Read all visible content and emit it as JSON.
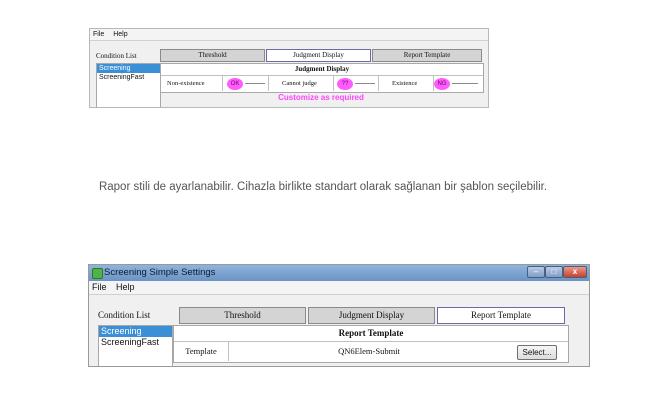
{
  "shot1": {
    "menu": [
      "File",
      "Help"
    ],
    "condition_list_label": "Condition List",
    "tabs": [
      "Threshold",
      "Judgment Display",
      "Report Template"
    ],
    "list_items": [
      "Screening",
      "ScreeningFast"
    ],
    "panel_title": "Judgment Display",
    "cells": [
      {
        "label": "Non-existence",
        "marker": "OK"
      },
      {
        "label": "Cannot judge",
        "marker": "??"
      },
      {
        "label": "Existence",
        "marker": "NG"
      }
    ],
    "annotation": "Customize as required",
    "annotation_color": "#ff44ff"
  },
  "caption": "Rapor stili de ayarlanabilir. Cihazla birlikte standart olarak sağlanan bir şablon seçilebilir.",
  "shot2": {
    "window_title": "Screening Simple Settings",
    "menu": [
      "File",
      "Help"
    ],
    "condition_list_label": "Condition List",
    "tabs": [
      "Threshold",
      "Judgment Display",
      "Report Template"
    ],
    "list_items": [
      "Screening",
      "ScreeningFast"
    ],
    "panel_title": "Report Template",
    "template_label": "Template",
    "template_value": "QN6Elem-Submit",
    "select_button": "Select...",
    "window_buttons": {
      "minimize": "–",
      "maximize": "□",
      "close": "x"
    },
    "selection_color": "#3b8fd6"
  }
}
